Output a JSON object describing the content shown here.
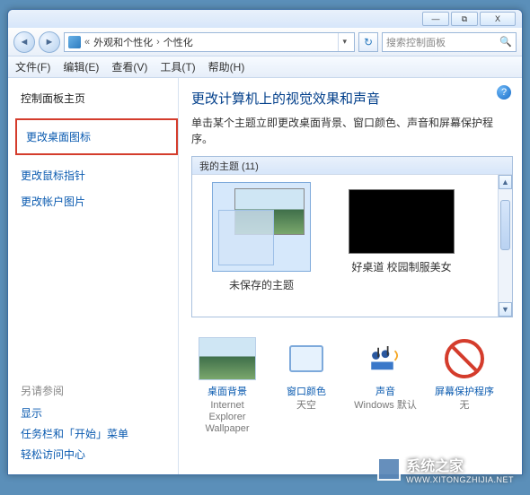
{
  "window_controls": {
    "min": "—",
    "max": "⧉",
    "close": "X"
  },
  "breadcrumb": {
    "sep": "«",
    "lvl1": "外观和个性化",
    "lvl2": "个性化",
    "arrow": "›"
  },
  "search": {
    "placeholder": "搜索控制面板"
  },
  "menu": {
    "file": "文件(F)",
    "edit": "编辑(E)",
    "view": "查看(V)",
    "tools": "工具(T)",
    "help": "帮助(H)"
  },
  "sidebar": {
    "home": "控制面板主页",
    "links": {
      "desktop_icons": "更改桌面图标",
      "mouse_pointers": "更改鼠标指针",
      "account_picture": "更改帐户图片"
    },
    "seealso": {
      "heading": "另请参阅",
      "display": "显示",
      "taskbar": "任务栏和「开始」菜单",
      "ease": "轻松访问中心"
    }
  },
  "content": {
    "heading": "更改计算机上的视觉效果和声音",
    "desc": "单击某个主题立即更改桌面背景、窗口颜色、声音和屏幕保护程序。",
    "themes_header": "我的主题 (11)",
    "theme1": "未保存的主题",
    "theme2": "好桌道 校园制服美女"
  },
  "cards": {
    "bg": {
      "label": "桌面背景",
      "sub": "Internet Explorer Wallpaper"
    },
    "wincolor": {
      "label": "窗口颜色",
      "sub": "天空"
    },
    "sound": {
      "label": "声音",
      "sub": "Windows 默认"
    },
    "ssaver": {
      "label": "屏幕保护程序",
      "sub": "无"
    }
  },
  "watermark": {
    "text": "系统之家",
    "url": "WWW.XITONGZHIJIA.NET"
  }
}
